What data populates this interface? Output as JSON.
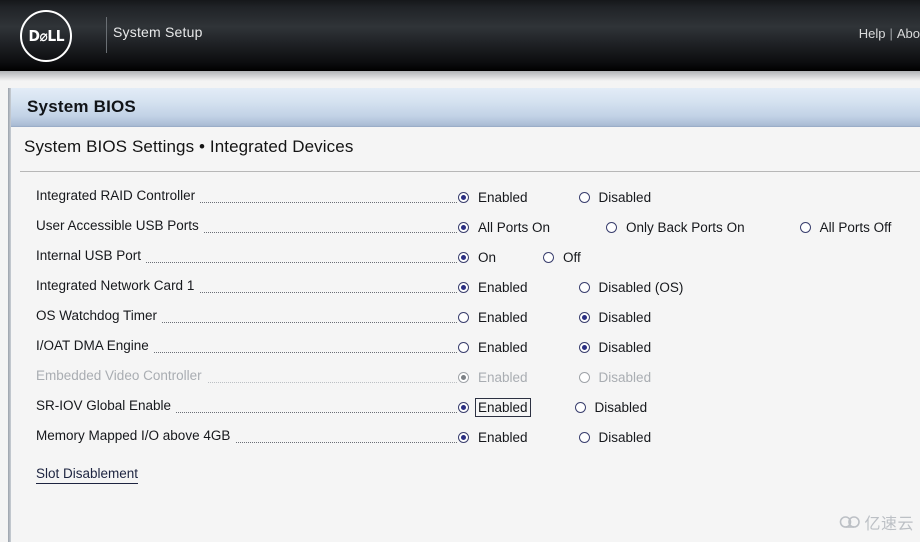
{
  "topbar": {
    "logo_text": "D⌀LL",
    "logo_icon": "dell-logo-icon",
    "title": "System Setup",
    "help_label": "Help",
    "separator": "|",
    "about_label": "Abo"
  },
  "window": {
    "titlebar": "System BIOS",
    "page_subtitle": "System BIOS Settings • Integrated Devices"
  },
  "settings": [
    {
      "label": "Integrated RAID Controller",
      "disabled": false,
      "options": [
        {
          "label": "Enabled",
          "selected": true,
          "focused": false,
          "gap": 0
        },
        {
          "label": "Disabled",
          "selected": false,
          "focused": false,
          "gap": 48
        }
      ]
    },
    {
      "label": "User Accessible USB Ports",
      "disabled": false,
      "options": [
        {
          "label": "All Ports On",
          "selected": true,
          "focused": false,
          "gap": 0
        },
        {
          "label": "Only Back Ports On",
          "selected": false,
          "focused": false,
          "gap": 53
        },
        {
          "label": "All Ports Off",
          "selected": false,
          "focused": false,
          "gap": 52
        }
      ]
    },
    {
      "label": "Internal USB Port",
      "disabled": false,
      "options": [
        {
          "label": "On",
          "selected": true,
          "focused": false,
          "gap": 0
        },
        {
          "label": "Off",
          "selected": false,
          "focused": false,
          "gap": 44
        }
      ]
    },
    {
      "label": "Integrated Network Card 1",
      "disabled": false,
      "options": [
        {
          "label": "Enabled",
          "selected": true,
          "focused": false,
          "gap": 0
        },
        {
          "label": "Disabled (OS)",
          "selected": false,
          "focused": false,
          "gap": 48
        }
      ]
    },
    {
      "label": "OS Watchdog Timer",
      "disabled": false,
      "options": [
        {
          "label": "Enabled",
          "selected": false,
          "focused": false,
          "gap": 0
        },
        {
          "label": "Disabled",
          "selected": true,
          "focused": false,
          "gap": 48
        }
      ]
    },
    {
      "label": "I/OAT DMA Engine",
      "disabled": false,
      "options": [
        {
          "label": "Enabled",
          "selected": false,
          "focused": false,
          "gap": 0
        },
        {
          "label": "Disabled",
          "selected": true,
          "focused": false,
          "gap": 48
        }
      ]
    },
    {
      "label": "Embedded Video Controller",
      "disabled": true,
      "options": [
        {
          "label": "Enabled",
          "selected": true,
          "focused": false,
          "gap": 0
        },
        {
          "label": "Disabled",
          "selected": false,
          "focused": false,
          "gap": 48
        }
      ]
    },
    {
      "label": "SR-IOV Global Enable",
      "disabled": false,
      "options": [
        {
          "label": "Enabled",
          "selected": true,
          "focused": true,
          "gap": 0
        },
        {
          "label": "Disabled",
          "selected": false,
          "focused": false,
          "gap": 44
        }
      ]
    },
    {
      "label": "Memory Mapped I/O above 4GB",
      "disabled": false,
      "options": [
        {
          "label": "Enabled",
          "selected": true,
          "focused": false,
          "gap": 0
        },
        {
          "label": "Disabled",
          "selected": false,
          "focused": false,
          "gap": 48
        }
      ]
    }
  ],
  "footer": {
    "slot_disablement_link": "Slot Disablement"
  },
  "watermark": {
    "text": "亿速云",
    "icon": "cloud-icon"
  },
  "colors": {
    "accent_blue": "#2b2f82",
    "titlebar_blue": "#c2d2e6",
    "topbar_black": "#202327",
    "link_navy": "#1d2440",
    "disabled_gray": "#a9adb2"
  }
}
